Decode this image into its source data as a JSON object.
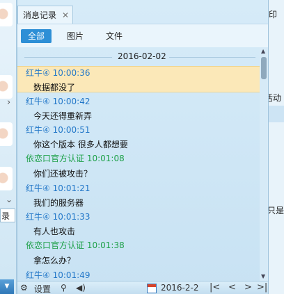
{
  "tab": {
    "title": "消息记录",
    "close": "✕"
  },
  "filters": [
    "全部",
    "图片",
    "文件"
  ],
  "date_header": "2016-02-02",
  "messages": [
    {
      "sender": "红牛④",
      "time": "10:00:36",
      "text": "数据都没了",
      "color": "blue",
      "highlight": true
    },
    {
      "sender": "红牛④",
      "time": "10:00:42",
      "text": "今天还得重新弄",
      "color": "blue"
    },
    {
      "sender": "红牛④",
      "time": "10:00:51",
      "text": "你这个版本 很多人都想要",
      "color": "blue"
    },
    {
      "sender": "依恋口官方认证",
      "time": "10:01:08",
      "text": "你们还被攻击？",
      "color": "green"
    },
    {
      "sender": "红牛④",
      "time": "10:01:21",
      "text": "我们的服务器",
      "color": "blue"
    },
    {
      "sender": "红牛④",
      "time": "10:01:33",
      "text": "有人也攻击",
      "color": "blue"
    },
    {
      "sender": "依恋口官方认证",
      "time": "10:01:38",
      "text": "拿怎么办？",
      "color": "green"
    },
    {
      "sender": "红牛④",
      "time": "10:01:49",
      "text": "",
      "color": "blue"
    }
  ],
  "toolbar": {
    "settings_label": "设置",
    "date_value": "2016-2-2",
    "nav": [
      "|<",
      "<",
      ">",
      ">|"
    ]
  },
  "left_strip": {
    "label": "录"
  },
  "right_strip": {
    "texts": [
      "印",
      "活动",
      "只是"
    ]
  },
  "colors": {
    "sender_blue": "#2277c8",
    "sender_green": "#1fa14a",
    "highlight": "#fbe8b8",
    "accent": "#2d8fd6"
  }
}
